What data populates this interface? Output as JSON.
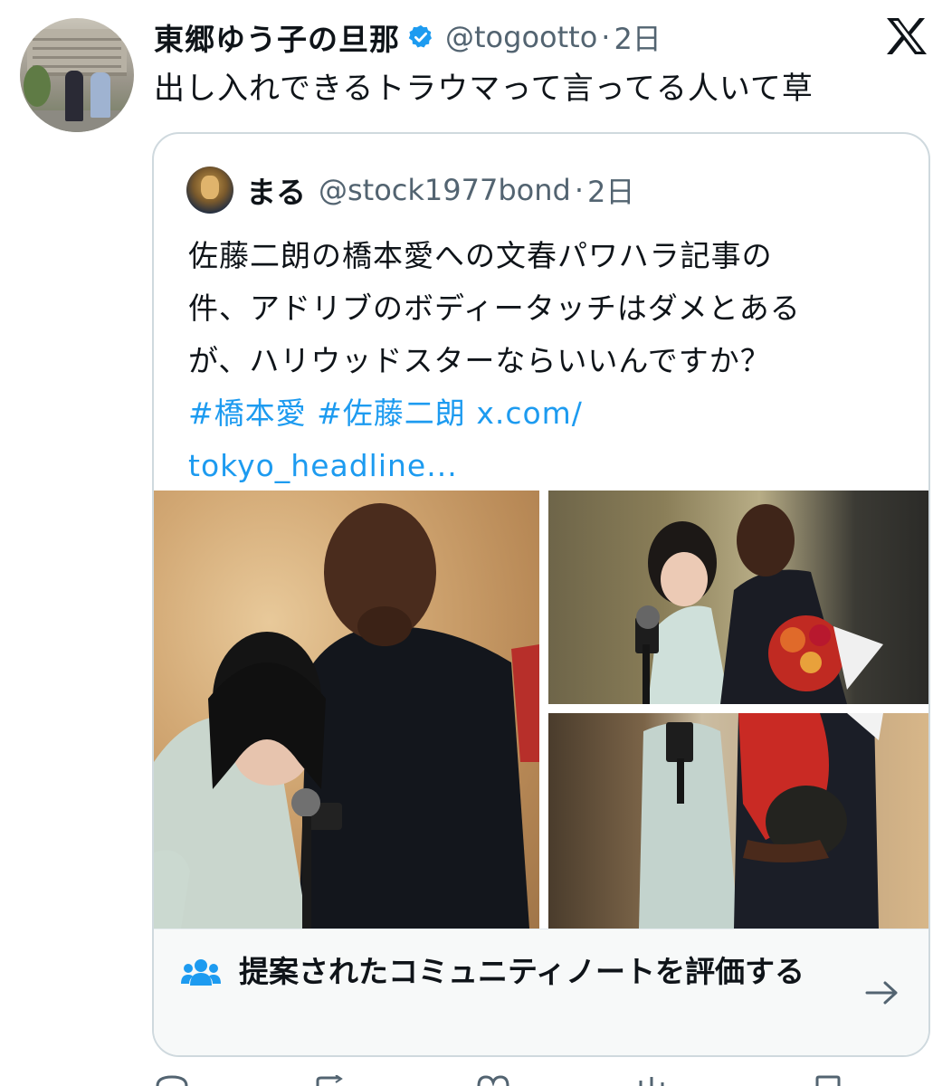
{
  "tweet": {
    "display_name": "東郷ゆう子の旦那",
    "handle": "@togootto",
    "separator": "·",
    "time": "2日",
    "text": "出し入れできるトラウマって言ってる人いて草"
  },
  "quote": {
    "display_name": "まる",
    "handle": "@stock1977bond",
    "separator": "·",
    "time": "2日",
    "lines": [
      "佐藤二朗の橋本愛への文春パワハラ記事の",
      "件、アドリブのボディータッチはダメとある",
      "が、ハリウッドスターならいいんですか？"
    ],
    "hashtag_1": "#橋本愛",
    "hashtag_2": "#佐藤二朗",
    "link_1": "x.com/",
    "link_2": "tokyo_headline..."
  },
  "community_note": {
    "label": "提案されたコミュニティノートを評価する"
  },
  "colors": {
    "accent": "#1d9bf0",
    "text": "#0f1419",
    "muted": "#536471",
    "border": "#cfd9de",
    "note_icon": "#1d9bf0"
  },
  "icons": {
    "verified": "verified-badge-icon",
    "brand": "x-logo-icon",
    "community": "community-notes-icon",
    "arrow": "arrow-right-icon"
  }
}
